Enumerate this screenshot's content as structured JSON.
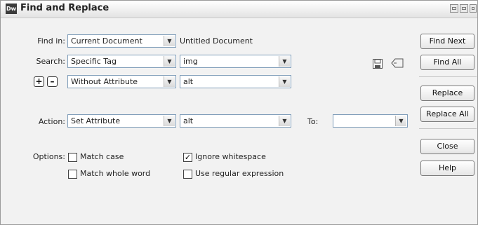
{
  "window": {
    "title": "Find and Replace",
    "logo_text": "Dw"
  },
  "find_in": {
    "label": "Find in:",
    "selected": "Current Document",
    "target": "Untitled Document"
  },
  "search": {
    "label": "Search:",
    "selected": "Specific Tag",
    "tag_value": "img"
  },
  "condition": {
    "selected": "Without Attribute",
    "attribute_value": "alt",
    "add_symbol": "+",
    "remove_symbol": "–"
  },
  "action": {
    "label": "Action:",
    "selected": "Set Attribute",
    "attribute_value": "alt",
    "to_label": "To:",
    "to_value": ""
  },
  "options": {
    "label": "Options:",
    "match_case": {
      "label": "Match case",
      "checked": false,
      "mark": ""
    },
    "match_whole_word": {
      "label": "Match whole word",
      "checked": false,
      "mark": ""
    },
    "ignore_whitespace": {
      "label": "Ignore whitespace",
      "checked": true,
      "mark": "✓"
    },
    "use_regex": {
      "label": "Use regular expression",
      "checked": false,
      "mark": ""
    }
  },
  "buttons": {
    "find_next": "Find Next",
    "find_all": "Find All",
    "replace": "Replace",
    "replace_all": "Replace All",
    "close": "Close",
    "help": "Help"
  },
  "icons": {
    "save": "save-query-icon",
    "load": "load-query-icon"
  },
  "colors": {
    "accent_border": "#7f9db9",
    "background": "#f2f2f2"
  }
}
